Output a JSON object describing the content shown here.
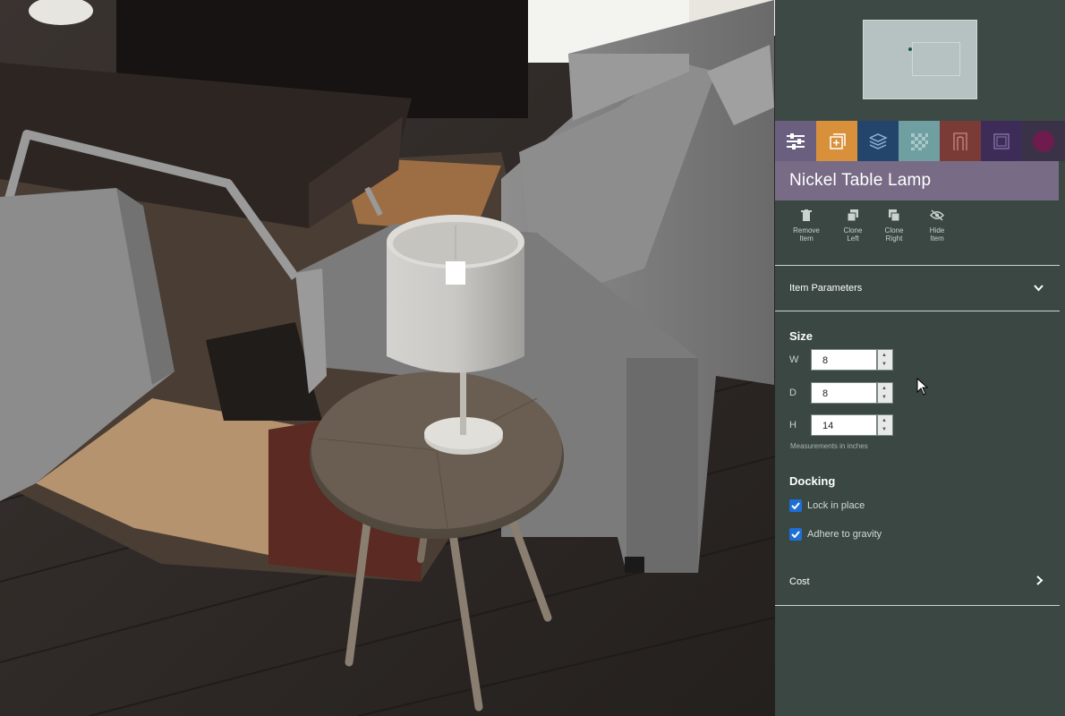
{
  "panel": {
    "item_title": "Nickel Table Lamp",
    "tabs": [
      {
        "name": "settings-sliders-icon",
        "color": "#6b5f80"
      },
      {
        "name": "add-object-icon",
        "color": "#d8913a"
      },
      {
        "name": "layers-icon",
        "color": "#23456c"
      },
      {
        "name": "texture-pattern-icon",
        "color": "#6f9fa1"
      },
      {
        "name": "door-icon",
        "color": "#7a3b36"
      },
      {
        "name": "frame-icon",
        "color": "#3e2c58"
      },
      {
        "name": "circle-icon",
        "color": "#6e1b4e"
      }
    ],
    "actions": {
      "remove": [
        "Remove",
        "Item"
      ],
      "clone_left": [
        "Clone",
        "Left"
      ],
      "clone_right": [
        "Clone",
        "Right"
      ],
      "hide": [
        "Hide",
        "Item"
      ]
    },
    "item_parameters_label": "Item Parameters",
    "size": {
      "title": "Size",
      "w_label": "W",
      "w_value": "8",
      "d_label": "D",
      "d_value": "8",
      "h_label": "H",
      "h_value": "14",
      "note": "Measurements in inches"
    },
    "docking": {
      "title": "Docking",
      "lock_label": "Lock in place",
      "lock_checked": true,
      "gravity_label": "Adhere to gravity",
      "gravity_checked": true
    },
    "cost_label": "Cost"
  },
  "colors": {
    "panel_bg": "#3a4742",
    "header_bg": "#786b86",
    "checkbox": "#1e6fd6"
  }
}
